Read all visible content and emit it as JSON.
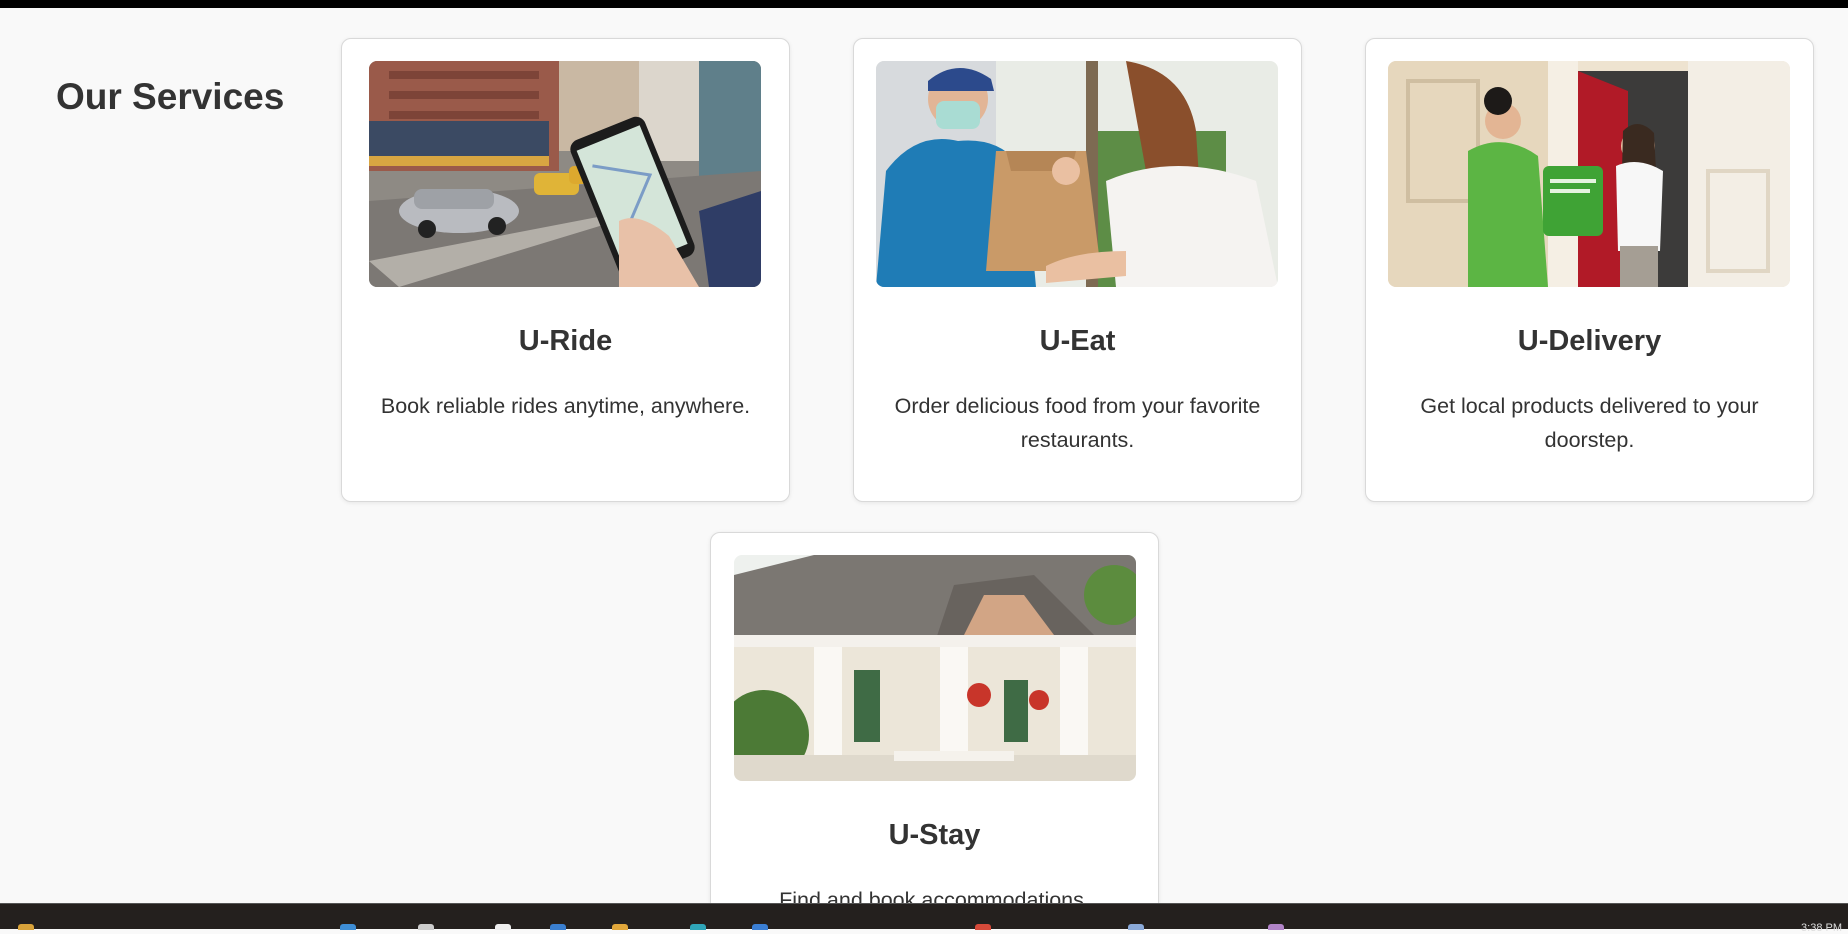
{
  "page": {
    "title": "Our Services"
  },
  "services": [
    {
      "title": "U-Ride",
      "description": "Book reliable rides anytime, anywhere.",
      "image": "city-street-phone-ride-app"
    },
    {
      "title": "U-Eat",
      "description": "Order delicious food from your favorite restaurants.",
      "image": "food-delivery-handoff"
    },
    {
      "title": "U-Delivery",
      "description": "Get local products delivered to your doorstep.",
      "image": "grocery-doorstep-delivery"
    },
    {
      "title": "U-Stay",
      "description": "Find and book accommodations.",
      "image": "house-with-porch"
    }
  ],
  "taskbar": {
    "clock": "3:38 PM",
    "icons": [
      "start-icon",
      "search-icon",
      "file-explorer-icon",
      "edge-browser-icon",
      "folder-icon",
      "store-icon",
      "chrome-icon",
      "settings-icon",
      "photos-icon",
      "music-icon",
      "mail-icon"
    ]
  },
  "colors": {
    "background": "#f9f9f9",
    "card": "#ffffff",
    "text": "#333333"
  }
}
